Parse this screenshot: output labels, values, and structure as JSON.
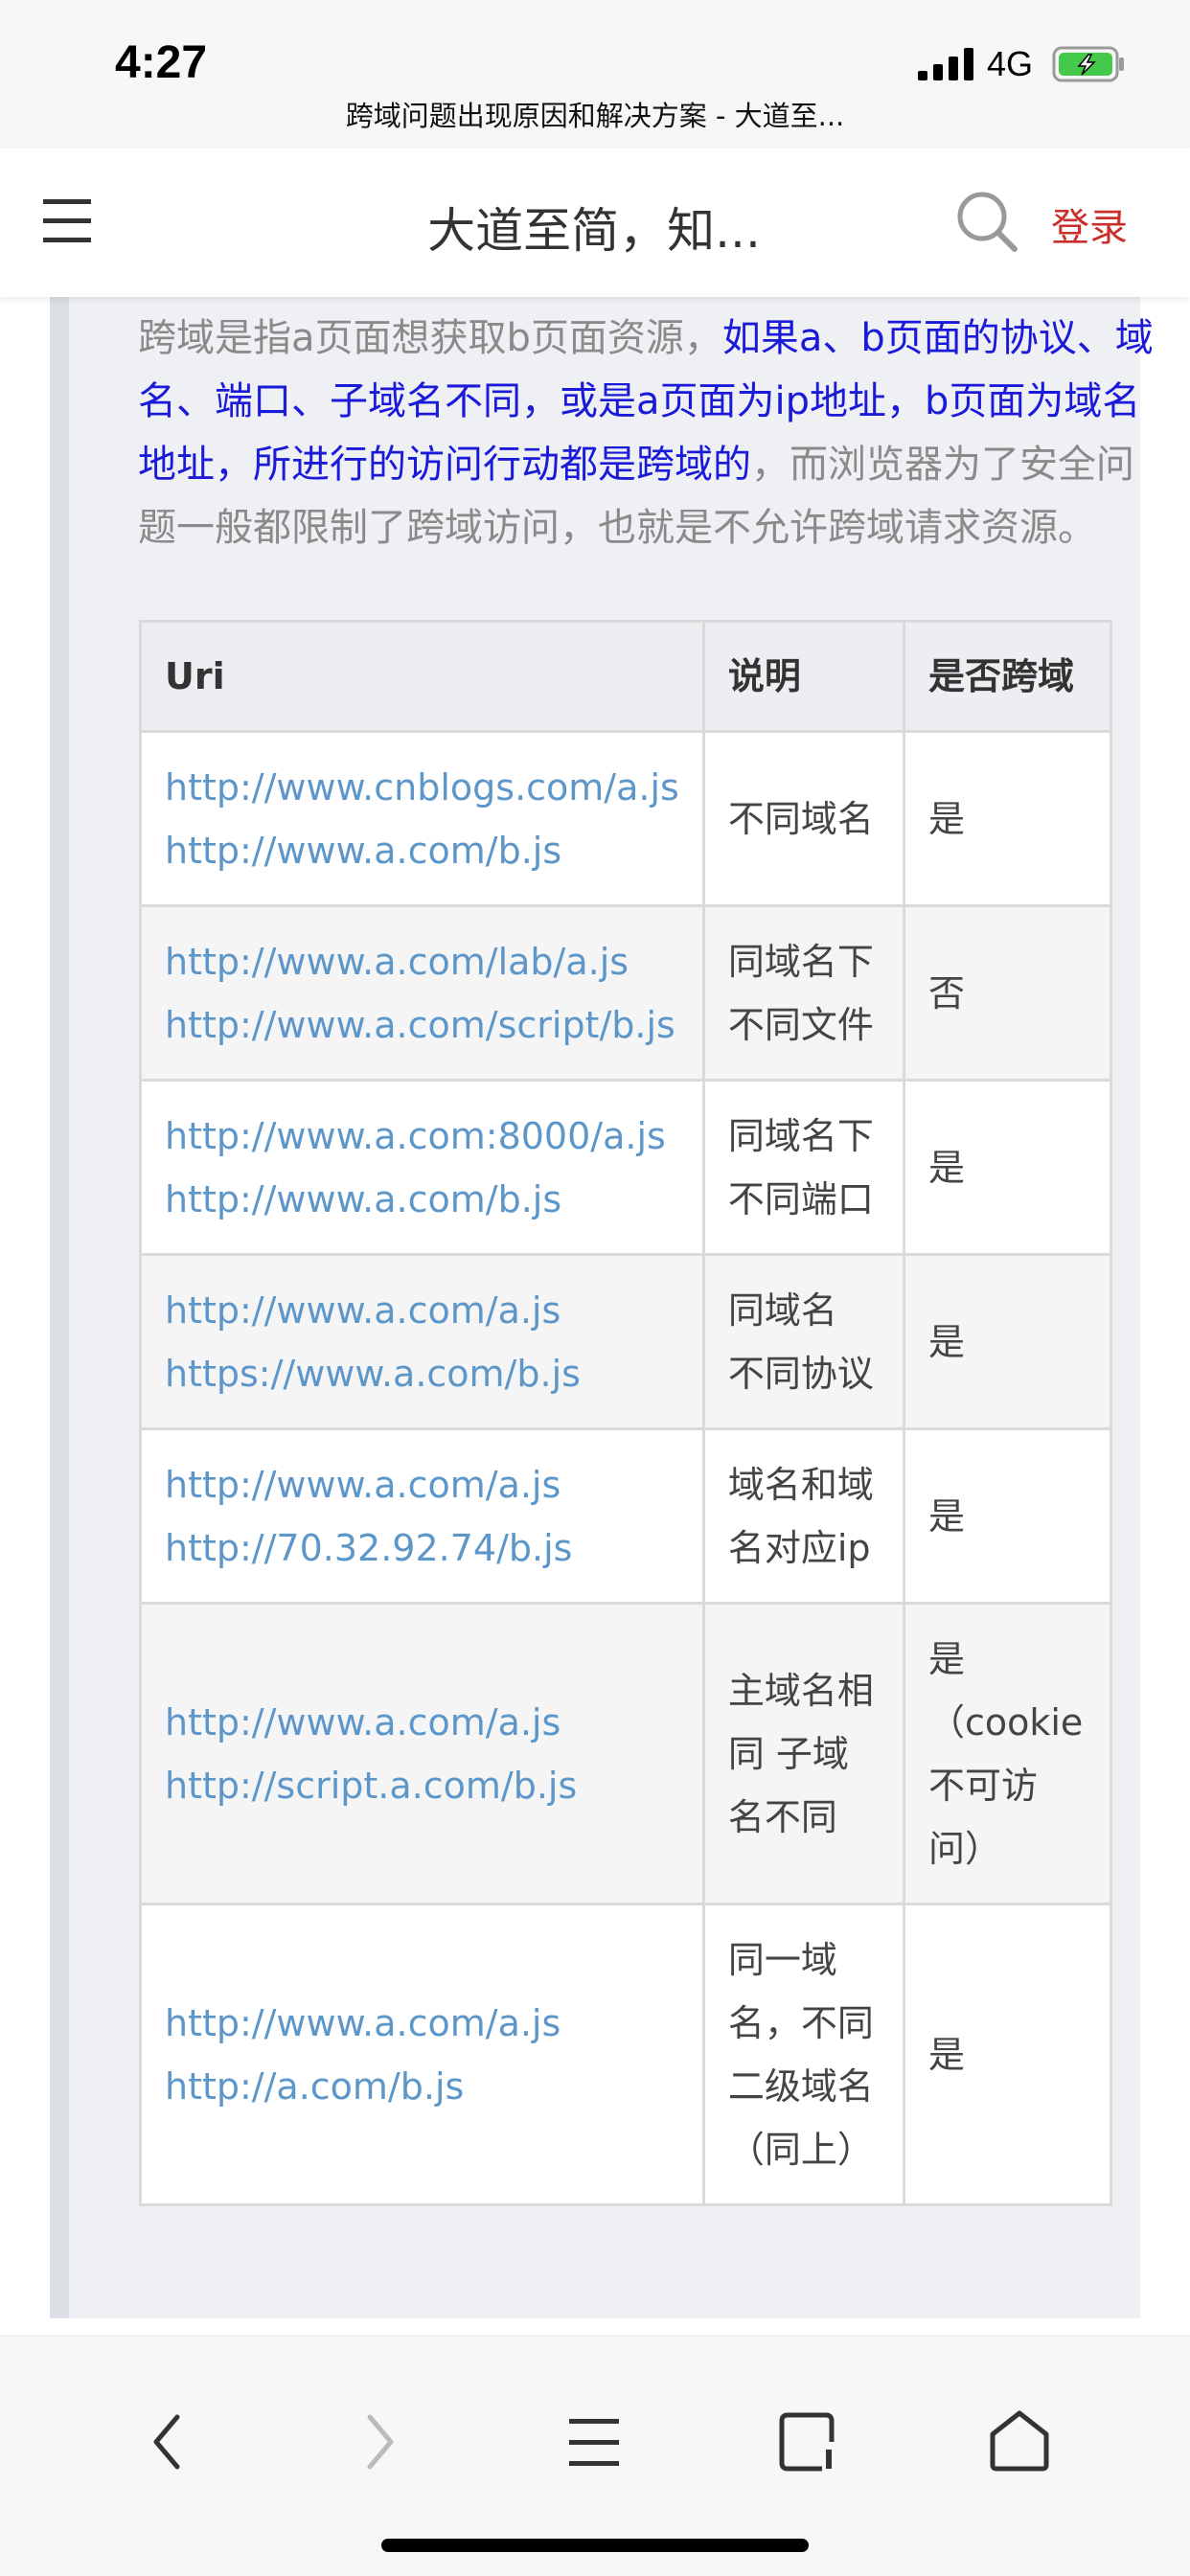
{
  "status_bar": {
    "time": "4:27",
    "network": "4G",
    "page_title": "跨域问题出现原因和解决方案 - 大道至..."
  },
  "header": {
    "title": "大道至简，知...",
    "login": "登录",
    "menu_icon": "hamburger-menu-icon",
    "search_icon": "search-icon"
  },
  "intro": {
    "part1": "跨域是指a页面想获取b页面资源，",
    "highlight": "如果a、b页面的协议、域名、端口、子域名不同，或是a页面为ip地址，b页面为域名地址，所进行的访问行动都是跨域的",
    "part2": "，而浏览器为了安全问题一般都限制了跨域访问，也就是不允许跨域请求资源。"
  },
  "table": {
    "headers": [
      "Uri",
      "说明",
      "是否跨域"
    ],
    "rows": [
      {
        "uri1": "http://www.cnblogs.com/a.js",
        "uri2": "http://www.a.com/b.js",
        "desc": "不同域名",
        "cross": "是"
      },
      {
        "uri1": "http://www.a.com/lab/a.js",
        "uri2": "http://www.a.com/script/b.js",
        "desc": "同域名下不同文件",
        "cross": "否"
      },
      {
        "uri1": "http://www.a.com:8000/a.js",
        "uri2": "http://www.a.com/b.js",
        "desc": "同域名下不同端口",
        "cross": "是"
      },
      {
        "uri1": "http://www.a.com/a.js",
        "uri2": "https://www.a.com/b.js",
        "desc": "同域名 不同协议",
        "cross": "是"
      },
      {
        "uri1": "http://www.a.com/a.js",
        "uri2": "http://70.32.92.74/b.js",
        "desc": "域名和域名对应ip",
        "cross": "是"
      },
      {
        "uri1": "http://www.a.com/a.js",
        "uri2": "http://script.a.com/b.js",
        "desc": "主域名相同 子域名不同",
        "cross": "是（cookie不可访问）"
      },
      {
        "uri1": "http://www.a.com/a.js",
        "uri2": "http://a.com/b.js",
        "desc": "同一域名，不同二级域名（同上）",
        "cross": "是"
      }
    ]
  },
  "toolbar": {
    "icons": [
      "back-icon",
      "forward-icon",
      "menu-icon",
      "tabs-icon",
      "home-icon"
    ]
  },
  "colors": {
    "login": "#c9302c",
    "highlight": "#1a1ad8",
    "link": "#5d96c8"
  }
}
